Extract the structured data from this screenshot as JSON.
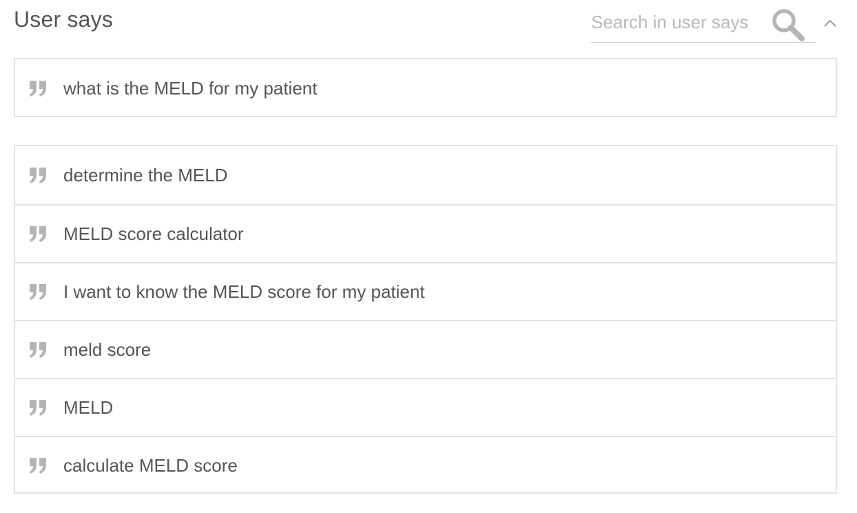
{
  "header": {
    "title": "User says",
    "search": {
      "placeholder": "Search in user says",
      "value": ""
    },
    "icons": {
      "search": "search-icon",
      "collapse": "chevron-up-icon"
    }
  },
  "pending": {
    "items": [
      {
        "text": "what is the MELD for my patient",
        "icon": "quote-icon"
      }
    ]
  },
  "examples": {
    "items": [
      {
        "text": "determine the MELD",
        "icon": "quote-icon"
      },
      {
        "text": "MELD score calculator",
        "icon": "quote-icon"
      },
      {
        "text": "I want to know the MELD score for my patient",
        "icon": "quote-icon"
      },
      {
        "text": "meld score",
        "icon": "quote-icon"
      },
      {
        "text": "MELD",
        "icon": "quote-icon"
      },
      {
        "text": "calculate MELD score",
        "icon": "quote-icon"
      }
    ]
  },
  "colors": {
    "text": "#555555",
    "placeholder": "#b9b9b9",
    "border": "#e3e3e3",
    "icon": "#b5b5b5"
  }
}
